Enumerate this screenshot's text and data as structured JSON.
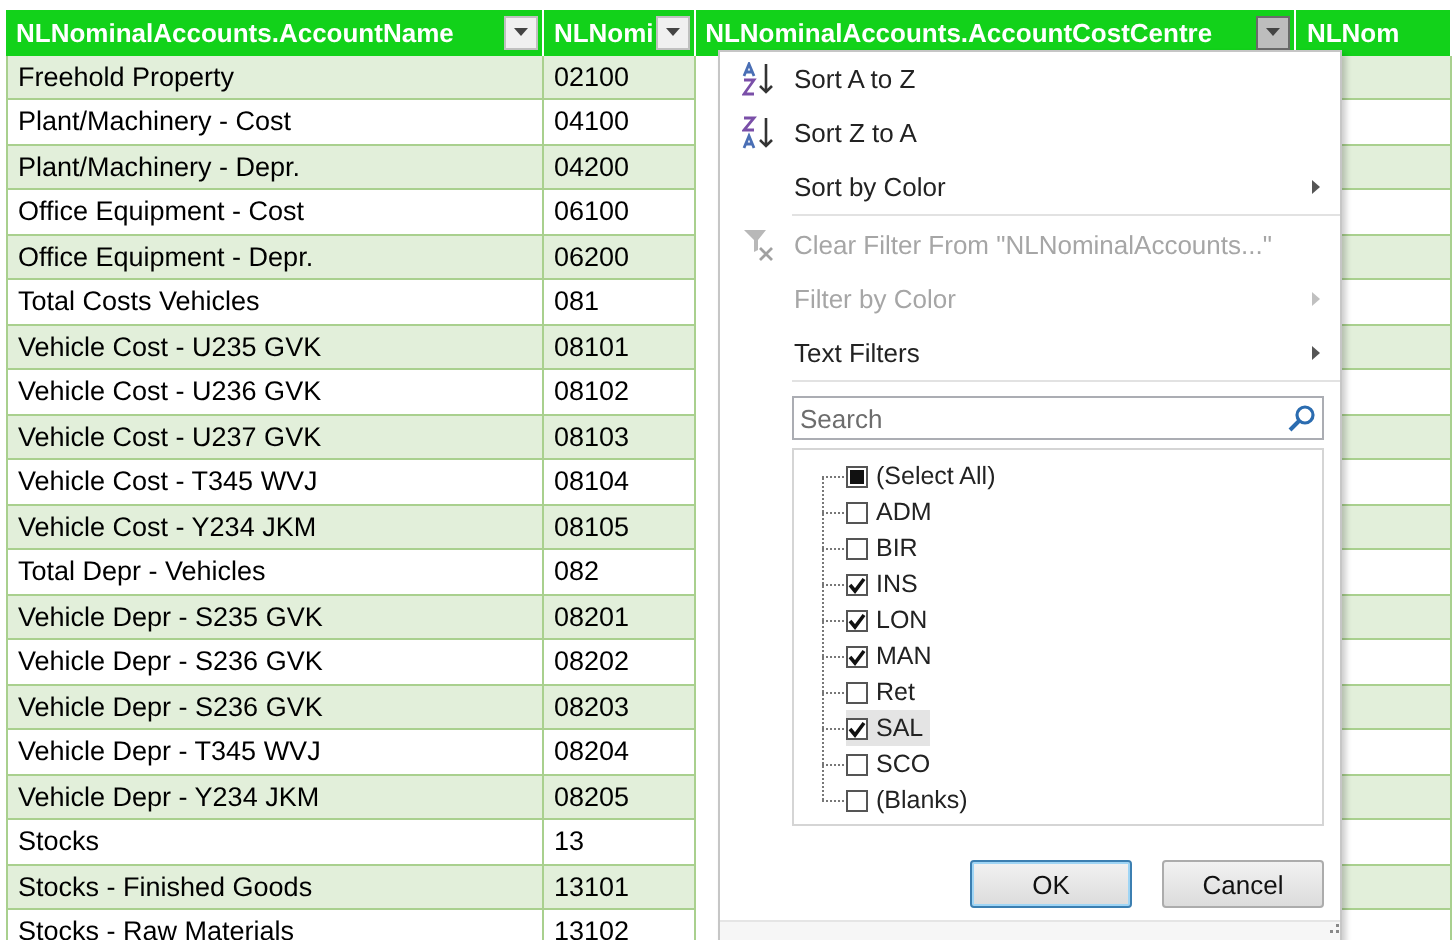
{
  "table": {
    "columns": [
      {
        "header": "NLNominalAccounts.AccountName",
        "filter_button": true,
        "filter_open": false
      },
      {
        "header": "NLNomi",
        "filter_button": true,
        "filter_open": false
      },
      {
        "header": "NLNominalAccounts.AccountCostCentre",
        "filter_button": true,
        "filter_open": true
      },
      {
        "header": "NLNom",
        "filter_button": false
      }
    ],
    "rows": [
      {
        "cells": [
          "Freehold Property",
          "02100"
        ]
      },
      {
        "cells": [
          "Plant/Machinery - Cost",
          "04100"
        ]
      },
      {
        "cells": [
          "Plant/Machinery - Depr.",
          "04200"
        ]
      },
      {
        "cells": [
          "Office Equipment - Cost",
          "06100"
        ]
      },
      {
        "cells": [
          "Office Equipment - Depr.",
          "06200"
        ]
      },
      {
        "cells": [
          "Total Costs Vehicles",
          "081"
        ]
      },
      {
        "cells": [
          "Vehicle Cost - U235 GVK",
          "08101"
        ]
      },
      {
        "cells": [
          "Vehicle Cost - U236 GVK",
          "08102"
        ]
      },
      {
        "cells": [
          "Vehicle Cost - U237 GVK",
          "08103"
        ]
      },
      {
        "cells": [
          "Vehicle Cost - T345 WVJ",
          "08104"
        ]
      },
      {
        "cells": [
          "Vehicle Cost - Y234 JKM",
          "08105"
        ]
      },
      {
        "cells": [
          "Total Depr - Vehicles",
          "082"
        ]
      },
      {
        "cells": [
          "Vehicle Depr - S235 GVK",
          "08201"
        ]
      },
      {
        "cells": [
          "Vehicle Depr - S236 GVK",
          "08202"
        ]
      },
      {
        "cells": [
          "Vehicle Depr - S236 GVK",
          "08203"
        ]
      },
      {
        "cells": [
          "Vehicle Depr - T345 WVJ",
          "08204"
        ]
      },
      {
        "cells": [
          "Vehicle Depr - Y234 JKM",
          "08205"
        ]
      },
      {
        "cells": [
          "Stocks",
          "13"
        ]
      },
      {
        "cells": [
          "Stocks - Finished Goods",
          "13101"
        ]
      },
      {
        "cells": [
          "Stocks - Raw Materials",
          "13102"
        ]
      }
    ]
  },
  "filter_menu": {
    "items": [
      {
        "label": "Sort A to Z",
        "kind": "sort-ascending",
        "disabled": false,
        "submenu": false,
        "separator_after": false
      },
      {
        "label": "Sort Z to A",
        "kind": "sort-descending",
        "disabled": false,
        "submenu": false,
        "separator_after": false
      },
      {
        "label": "Sort by Color",
        "kind": "plain",
        "disabled": false,
        "submenu": true,
        "separator_after": true
      },
      {
        "label": "Clear Filter From \"NLNominalAccounts...\"",
        "kind": "clear-filter",
        "disabled": true,
        "submenu": false,
        "separator_after": false
      },
      {
        "label": "Filter by Color",
        "kind": "plain",
        "disabled": true,
        "submenu": true,
        "separator_after": false
      },
      {
        "label": "Text Filters",
        "kind": "plain",
        "disabled": false,
        "submenu": true,
        "separator_after": true
      }
    ],
    "search": {
      "placeholder": "Search"
    },
    "options": [
      {
        "label": "(Select All)",
        "checked": false,
        "indeterminate": true,
        "selected": false
      },
      {
        "label": "ADM",
        "checked": false,
        "indeterminate": false,
        "selected": false
      },
      {
        "label": "BIR",
        "checked": false,
        "indeterminate": false,
        "selected": false
      },
      {
        "label": "INS",
        "checked": true,
        "indeterminate": false,
        "selected": false
      },
      {
        "label": "LON",
        "checked": true,
        "indeterminate": false,
        "selected": false
      },
      {
        "label": "MAN",
        "checked": true,
        "indeterminate": false,
        "selected": false
      },
      {
        "label": "Ret",
        "checked": false,
        "indeterminate": false,
        "selected": false
      },
      {
        "label": "SAL",
        "checked": true,
        "indeterminate": false,
        "selected": true
      },
      {
        "label": "SCO",
        "checked": false,
        "indeterminate": false,
        "selected": false
      },
      {
        "label": "(Blanks)",
        "checked": false,
        "indeterminate": false,
        "selected": false
      }
    ],
    "buttons": [
      {
        "label": "OK",
        "default": true
      },
      {
        "label": "Cancel",
        "default": false
      }
    ]
  }
}
